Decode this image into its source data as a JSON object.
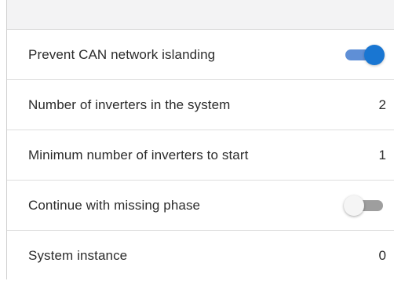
{
  "settings": {
    "rows": [
      {
        "label": "Prevent CAN network islanding",
        "type": "toggle",
        "checked": true
      },
      {
        "label": "Number of inverters in the system",
        "type": "value",
        "value": "2"
      },
      {
        "label": "Minimum number of inverters to start",
        "type": "value",
        "value": "1"
      },
      {
        "label": "Continue with missing phase",
        "type": "toggle",
        "checked": false
      },
      {
        "label": "System instance",
        "type": "value",
        "value": "0"
      }
    ]
  },
  "colors": {
    "toggle_on_thumb": "#1976d2",
    "toggle_on_track": "#5f8fd6",
    "toggle_off_thumb": "#f5f5f5",
    "toggle_off_track": "#9e9e9e",
    "header_bg": "#f3f3f4"
  }
}
